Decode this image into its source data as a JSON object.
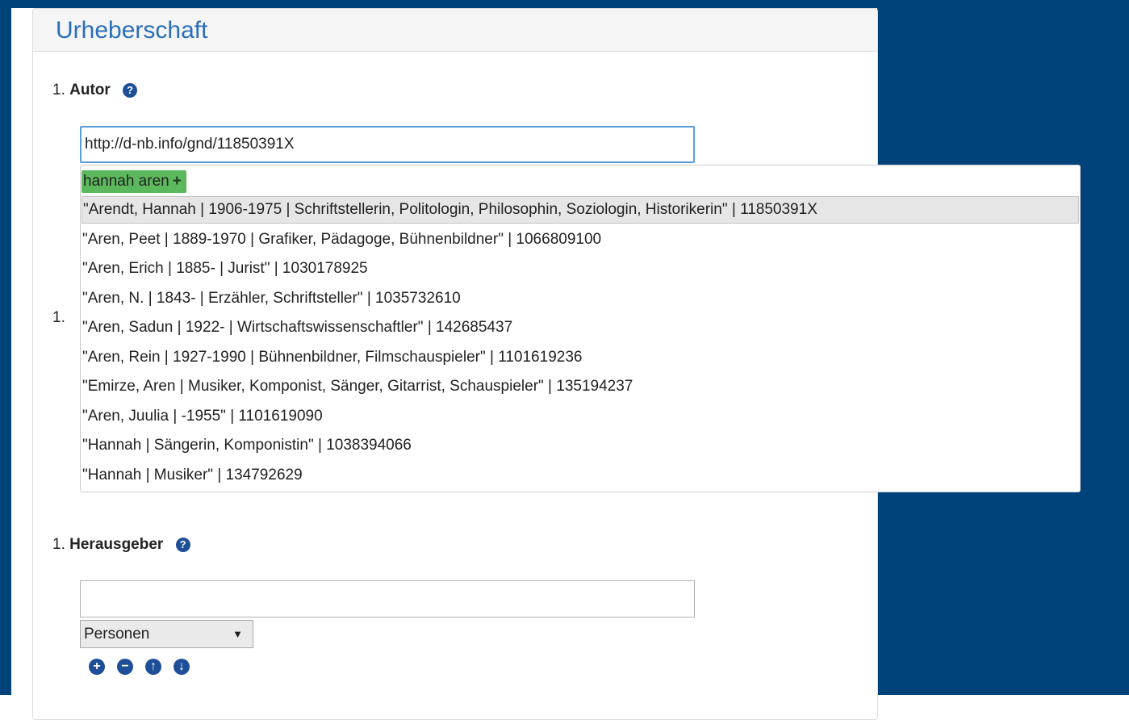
{
  "panel": {
    "title": "Urheberschaft"
  },
  "autor": {
    "number": "1.",
    "label": "Autor",
    "help_glyph": "?",
    "input_value": "http://d-nb.info/gnd/11850391X",
    "row_number": "1.",
    "new_entry": "hannah aren",
    "new_entry_plus": "+",
    "results": [
      "\"Arendt, Hannah | 1906-1975 | Schriftstellerin, Politologin, Philosophin, Soziologin, Historikerin\" | 11850391X",
      "\"Aren, Peet | 1889-1970 | Grafiker, Pädagoge, Bühnenbildner\" | 1066809100",
      "\"Aren, Erich | 1885- | Jurist\" | 1030178925",
      "\"Aren, N. | 1843- | Erzähler, Schriftsteller\" | 1035732610",
      "\"Aren, Sadun | 1922- | Wirtschaftswissenschaftler\" | 142685437",
      "\"Aren, Rein | 1927-1990 | Bühnenbildner, Filmschauspieler\" | 1101619236",
      "\"Emirze, Aren | Musiker, Komponist, Sänger, Gitarrist, Schauspieler\" | 135194237",
      "\"Aren, Juulia | -1955\" | 1101619090",
      "\"Hannah | Sängerin, Komponistin\" | 1038394066",
      "\"Hannah | Musiker\" | 134792629"
    ]
  },
  "herausgeber": {
    "number": "1.",
    "label": "Herausgeber",
    "help_glyph": "?",
    "input_value": "",
    "select_value": "Personen",
    "select_chevron": "▼",
    "actions": {
      "add": "+",
      "remove": "−",
      "up": "↑",
      "down": "↓"
    }
  },
  "colors": {
    "accent": "#2a6ebb",
    "background": "#00427a",
    "new_entry_bg": "#5cb85c"
  },
  "icons": [
    "help-icon",
    "plus-icon",
    "add-icon",
    "remove-icon",
    "arrow-up-icon",
    "arrow-down-icon"
  ]
}
